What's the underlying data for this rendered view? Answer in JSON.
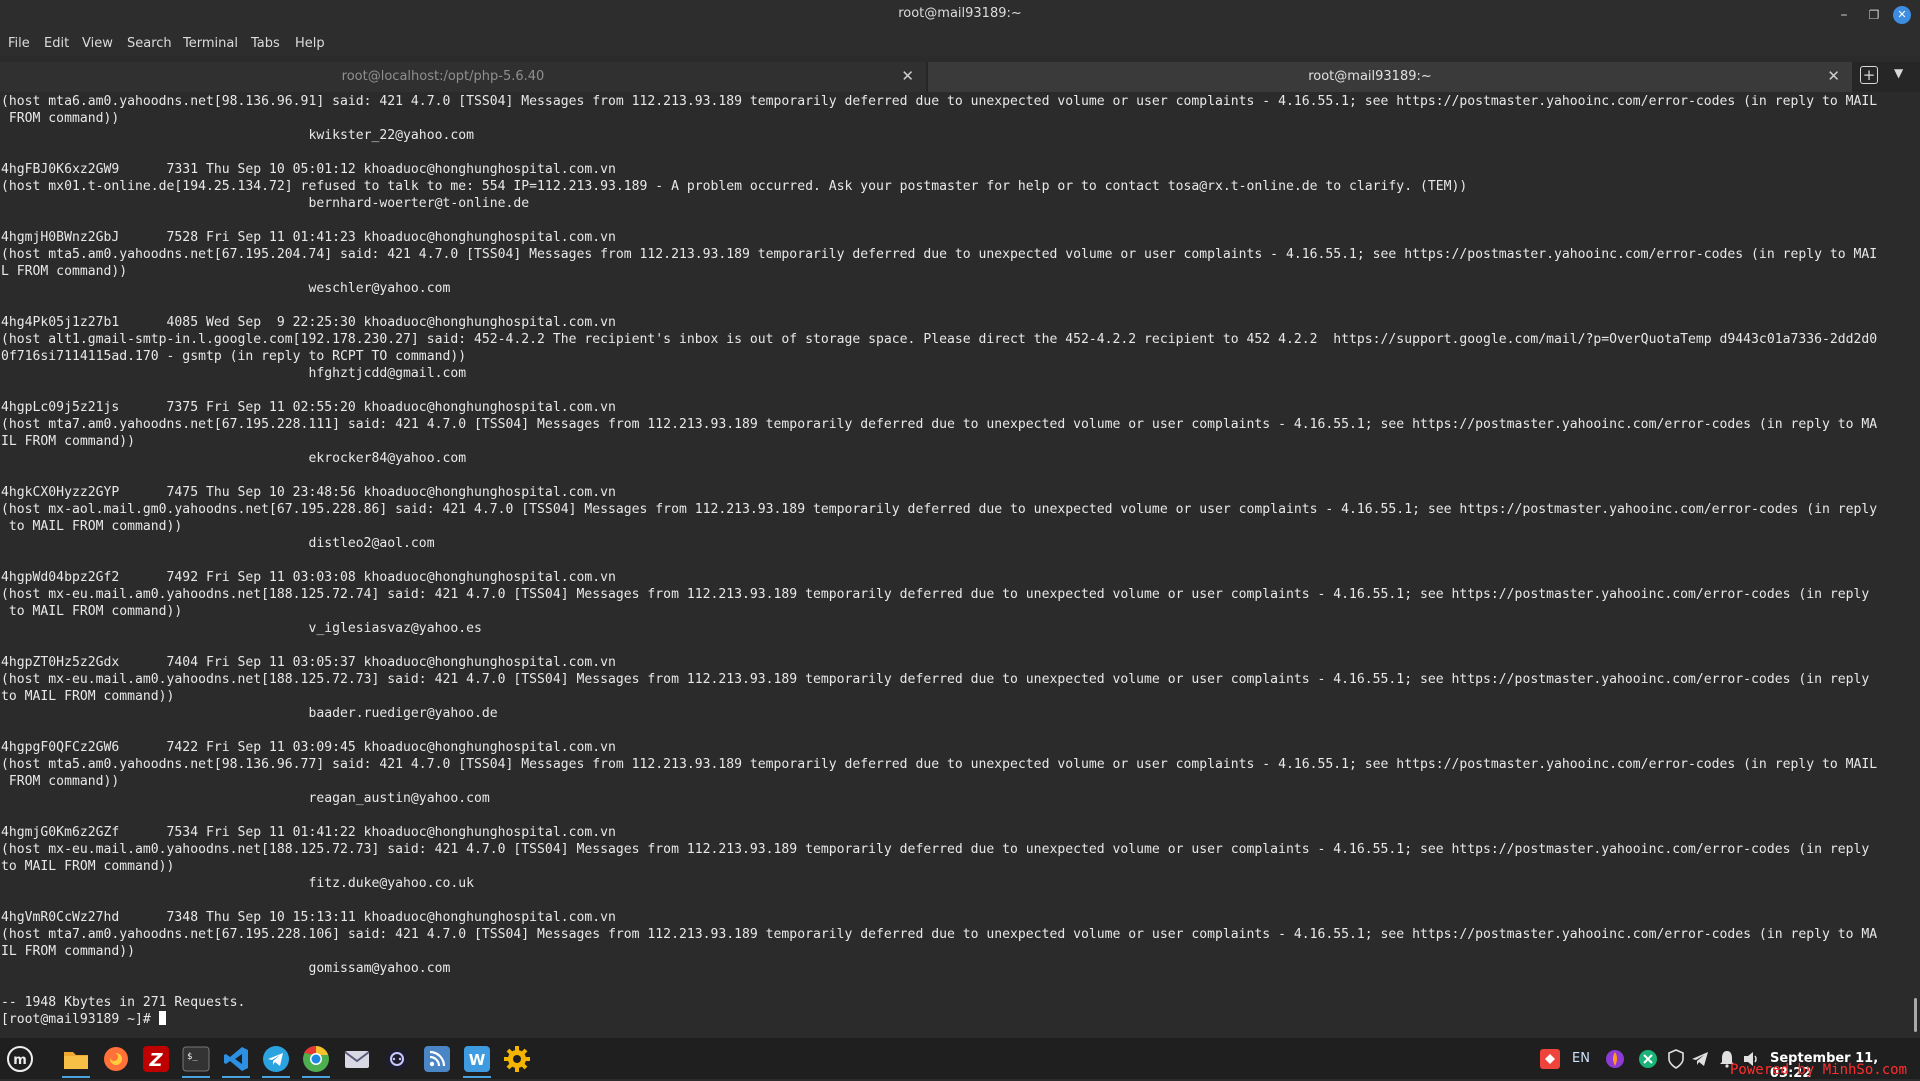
{
  "window": {
    "title": "root@mail93189:~"
  },
  "menu": [
    "File",
    "Edit",
    "View",
    "Search",
    "Terminal",
    "Tabs",
    "Help"
  ],
  "tabs": [
    {
      "label": "root@localhost:/opt/php-5.6.40",
      "active": false
    },
    {
      "label": "root@mail93189:~",
      "active": true
    }
  ],
  "terminal": {
    "lines": [
      "(host mta6.am0.yahoodns.net[98.136.96.91] said: 421 4.7.0 [TSS04] Messages from 112.213.93.189 temporarily deferred due to unexpected volume or user complaints - 4.16.55.1; see https://postmaster.yahooinc.com/error-codes (in reply to MAIL",
      " FROM command))",
      "                                       kwikster_22@yahoo.com",
      "",
      "4hgFBJ0K6xz2GW9      7331 Thu Sep 10 05:01:12 khoaduoc@honghunghospital.com.vn",
      "(host mx01.t-online.de[194.25.134.72] refused to talk to me: 554 IP=112.213.93.189 - A problem occurred. Ask your postmaster for help or to contact tosa@rx.t-online.de to clarify. (TEM))",
      "                                       bernhard-woerter@t-online.de",
      "",
      "4hgmjH0BWnz2GbJ      7528 Fri Sep 11 01:41:23 khoaduoc@honghunghospital.com.vn",
      "(host mta5.am0.yahoodns.net[67.195.204.74] said: 421 4.7.0 [TSS04] Messages from 112.213.93.189 temporarily deferred due to unexpected volume or user complaints - 4.16.55.1; see https://postmaster.yahooinc.com/error-codes (in reply to MAI",
      "L FROM command))",
      "                                       weschler@yahoo.com",
      "",
      "4hg4Pk05j1z27b1      4085 Wed Sep  9 22:25:30 khoaduoc@honghunghospital.com.vn",
      "(host alt1.gmail-smtp-in.l.google.com[192.178.230.27] said: 452-4.2.2 The recipient's inbox is out of storage space. Please direct the 452-4.2.2 recipient to 452 4.2.2  https://support.google.com/mail/?p=OverQuotaTemp d9443c01a7336-2dd2d0",
      "0f716si7114115ad.170 - gsmtp (in reply to RCPT TO command))",
      "                                       hfghztjcdd@gmail.com",
      "",
      "4hgpLc09j5z21js      7375 Fri Sep 11 02:55:20 khoaduoc@honghunghospital.com.vn",
      "(host mta7.am0.yahoodns.net[67.195.228.111] said: 421 4.7.0 [TSS04] Messages from 112.213.93.189 temporarily deferred due to unexpected volume or user complaints - 4.16.55.1; see https://postmaster.yahooinc.com/error-codes (in reply to MA",
      "IL FROM command))",
      "                                       ekrocker84@yahoo.com",
      "",
      "4hgkCX0Hyzz2GYP      7475 Thu Sep 10 23:48:56 khoaduoc@honghunghospital.com.vn",
      "(host mx-aol.mail.gm0.yahoodns.net[67.195.228.86] said: 421 4.7.0 [TSS04] Messages from 112.213.93.189 temporarily deferred due to unexpected volume or user complaints - 4.16.55.1; see https://postmaster.yahooinc.com/error-codes (in reply",
      " to MAIL FROM command))",
      "                                       distleo2@aol.com",
      "",
      "4hgpWd04bpz2Gf2      7492 Fri Sep 11 03:03:08 khoaduoc@honghunghospital.com.vn",
      "(host mx-eu.mail.am0.yahoodns.net[188.125.72.74] said: 421 4.7.0 [TSS04] Messages from 112.213.93.189 temporarily deferred due to unexpected volume or user complaints - 4.16.55.1; see https://postmaster.yahooinc.com/error-codes (in reply",
      " to MAIL FROM command))",
      "                                       v_iglesiasvaz@yahoo.es",
      "",
      "4hgpZT0Hz5z2Gdx      7404 Fri Sep 11 03:05:37 khoaduoc@honghunghospital.com.vn",
      "(host mx-eu.mail.am0.yahoodns.net[188.125.72.73] said: 421 4.7.0 [TSS04] Messages from 112.213.93.189 temporarily deferred due to unexpected volume or user complaints - 4.16.55.1; see https://postmaster.yahooinc.com/error-codes (in reply",
      "to MAIL FROM command))",
      "                                       baader.ruediger@yahoo.de",
      "",
      "4hgpgF0QFCz2GW6      7422 Fri Sep 11 03:09:45 khoaduoc@honghunghospital.com.vn",
      "(host mta5.am0.yahoodns.net[98.136.96.77] said: 421 4.7.0 [TSS04] Messages from 112.213.93.189 temporarily deferred due to unexpected volume or user complaints - 4.16.55.1; see https://postmaster.yahooinc.com/error-codes (in reply to MAIL",
      " FROM command))",
      "                                       reagan_austin@yahoo.com",
      "",
      "4hgmjG0Km6z2GZf      7534 Fri Sep 11 01:41:22 khoaduoc@honghunghospital.com.vn",
      "(host mx-eu.mail.am0.yahoodns.net[188.125.72.73] said: 421 4.7.0 [TSS04] Messages from 112.213.93.189 temporarily deferred due to unexpected volume or user complaints - 4.16.55.1; see https://postmaster.yahooinc.com/error-codes (in reply",
      "to MAIL FROM command))",
      "                                       fitz.duke@yahoo.co.uk",
      "",
      "4hgVmR0CcWz27hd      7348 Thu Sep 10 15:13:11 khoaduoc@honghunghospital.com.vn",
      "(host mta7.am0.yahoodns.net[67.195.228.106] said: 421 4.7.0 [TSS04] Messages from 112.213.93.189 temporarily deferred due to unexpected volume or user complaints - 4.16.55.1; see https://postmaster.yahooinc.com/error-codes (in reply to MA",
      "IL FROM command))",
      "                                       gomissam@yahoo.com",
      "",
      "-- 1948 Kbytes in 271 Requests."
    ],
    "prompt": "[root@mail93189 ~]# "
  },
  "taskbar": {
    "apps": [
      "menu-icon",
      "files-icon",
      "firefox-icon",
      "filezilla-icon",
      "terminal-icon",
      "vscode-icon",
      "telegram-icon",
      "chrome-icon",
      "mail-icon",
      "chatgpt-icon",
      "rss-icon",
      "office-icon",
      "settings-icon"
    ],
    "tray_language": "EN",
    "clock": "September 11, 03:22"
  },
  "watermark": "Powered by MinhSo.com",
  "colors": {
    "terminal_bg": "#2b2b2b",
    "terminal_fg": "#e8e8e8",
    "accent": "#3d8ee0",
    "watermark": "#ff2e2e"
  }
}
